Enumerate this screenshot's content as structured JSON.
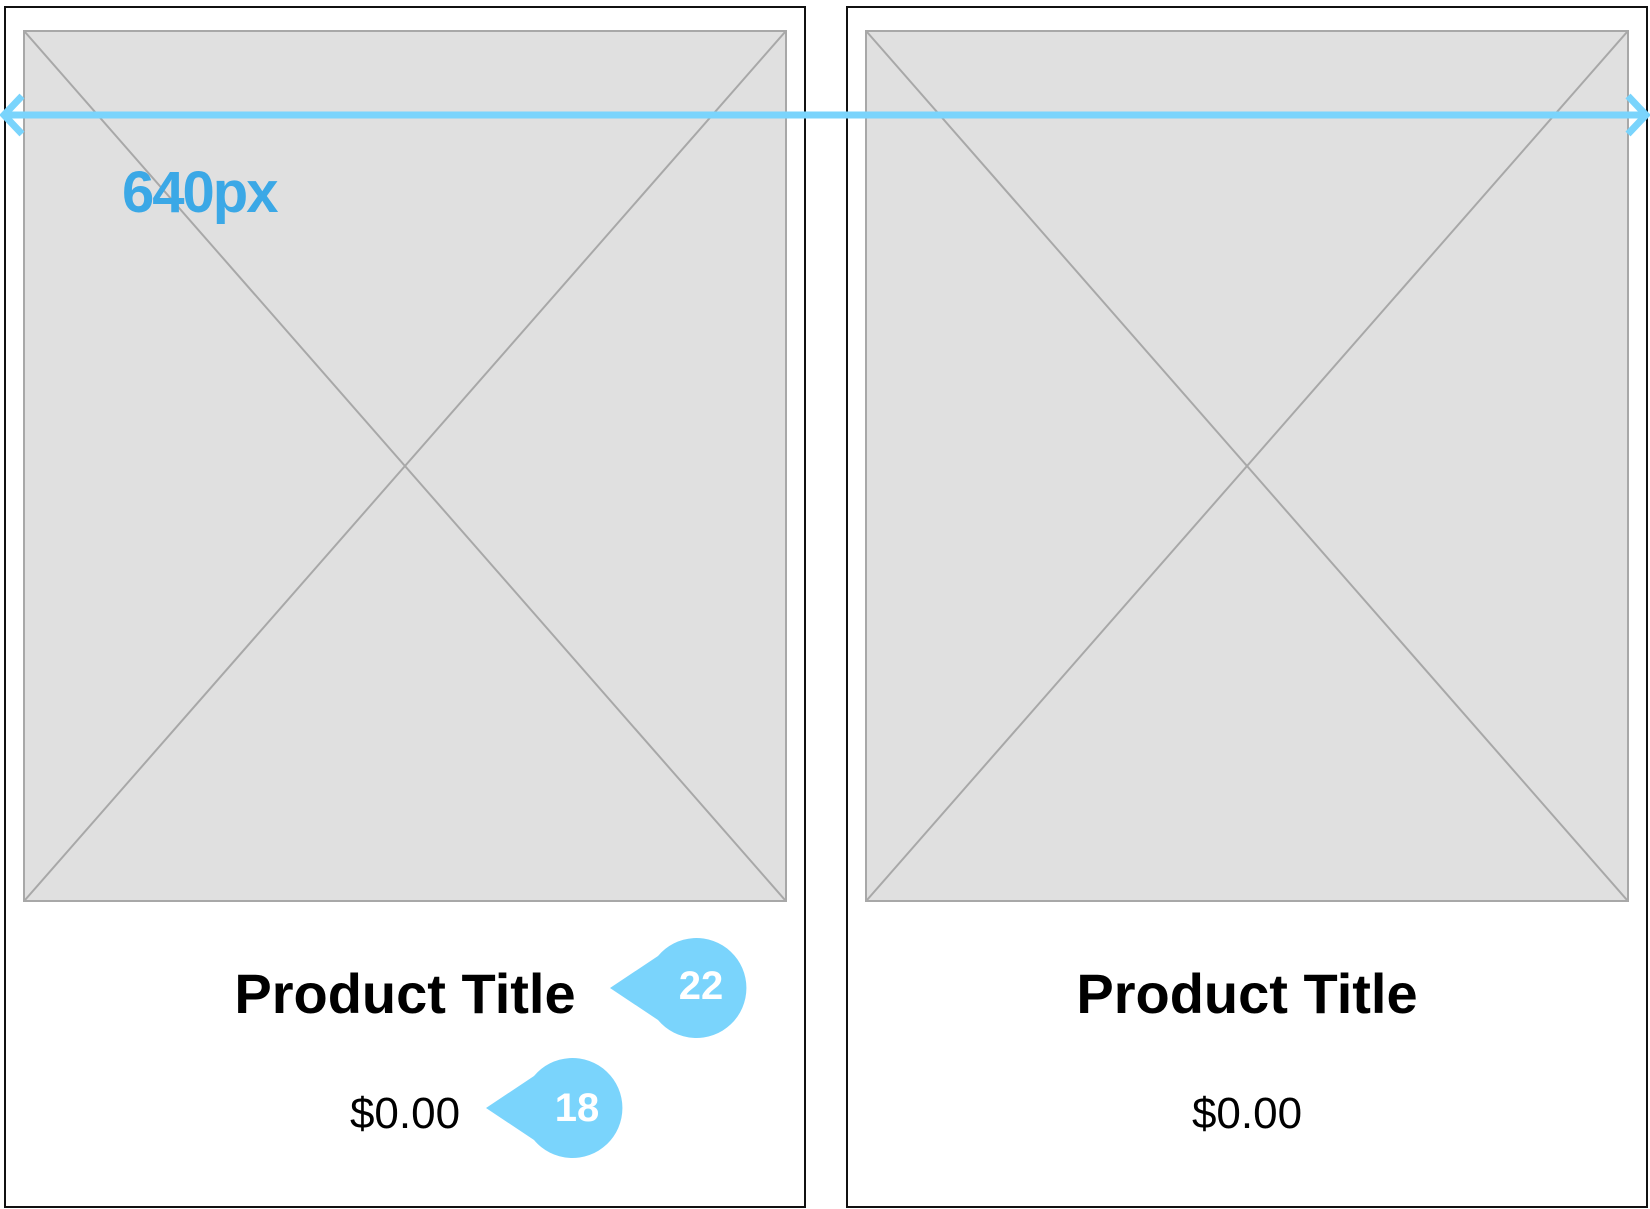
{
  "cards": [
    {
      "title": "Product Title",
      "price": "$0.00"
    },
    {
      "title": "Product Title",
      "price": "$0.00"
    }
  ],
  "annotations": {
    "width_label": "640px",
    "title_font_size": "22",
    "price_font_size": "18"
  },
  "colors": {
    "annotation": "#7ad4fc",
    "annotation_text": "#3ba8e6",
    "placeholder_fill": "#e0e0e0",
    "placeholder_stroke": "#a8a8a8",
    "card_border": "#111111"
  }
}
